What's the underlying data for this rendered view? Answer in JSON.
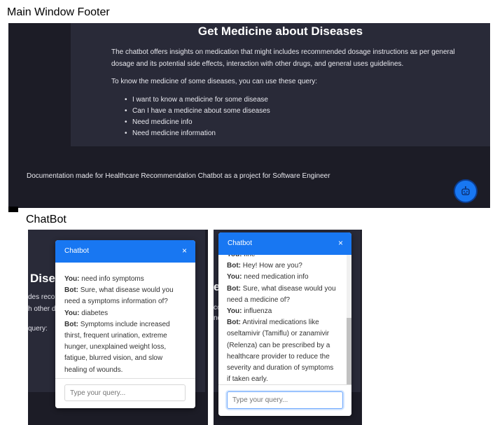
{
  "captions": {
    "main_window_footer": "Main Window Footer",
    "chatbot": "ChatBot"
  },
  "main": {
    "card_title": "Get Medicine about Diseases",
    "paragraph_1": "The chatbot offers insights on medication that might includes recommended dosage instructions as per general dosage and its potential side effects, interaction with other drugs, and general uses guidelines.",
    "paragraph_2": "To know the medicine of some diseases, you can use these query:",
    "queries": [
      "I want to know a medicine for some disease",
      "Can I have a medicine about some diseases",
      "Need medicine info",
      "Need medicine information"
    ],
    "footer_text": "Documentation made for Healthcare Recommendation Chatbot as a project for Software Engineer",
    "chat_button_icon": "robot-icon"
  },
  "chat_a": {
    "background": {
      "heading_fragment": "Dise",
      "line_1": "des reco",
      "line_2": "h other d",
      "line_3": "query:"
    },
    "header_title": "Chatbot",
    "close_icon": "×",
    "messages": [
      {
        "who": "You:",
        "text": "need info symptoms"
      },
      {
        "who": "Bot:",
        "text": "Sure, what disease would you need a symptoms information of?"
      },
      {
        "who": "You:",
        "text": "diabetes"
      },
      {
        "who": "Bot:",
        "text": "Symptoms include increased thirst, frequent urination, extreme hunger, unexplained weight loss, fatigue, blurred vision, and slow healing of wounds."
      }
    ],
    "input_placeholder": "Type your query..."
  },
  "chat_b": {
    "background": {
      "heading_fragment": "e",
      "line_1": "co",
      "line_2": "nd"
    },
    "header_title": "Chatbot",
    "close_icon": "×",
    "messages": [
      {
        "who": "You:",
        "text": "fine"
      },
      {
        "who": "Bot:",
        "text": "Hey! How are you?"
      },
      {
        "who": "You:",
        "text": "need medication info"
      },
      {
        "who": "Bot:",
        "text": "Sure, what disease would you need a medicine of?"
      },
      {
        "who": "You:",
        "text": "influenza"
      },
      {
        "who": "Bot:",
        "text": "Antiviral medications like oseltamivir (Tamiflu) or zanamivir (Relenza) can be prescribed by a healthcare provider to reduce the severity and duration of symptoms if taken early."
      }
    ],
    "input_placeholder": "Type your query..."
  },
  "colors": {
    "accent": "#1877f2",
    "dark_bg": "#1c1c26",
    "card_bg": "#292a38"
  }
}
